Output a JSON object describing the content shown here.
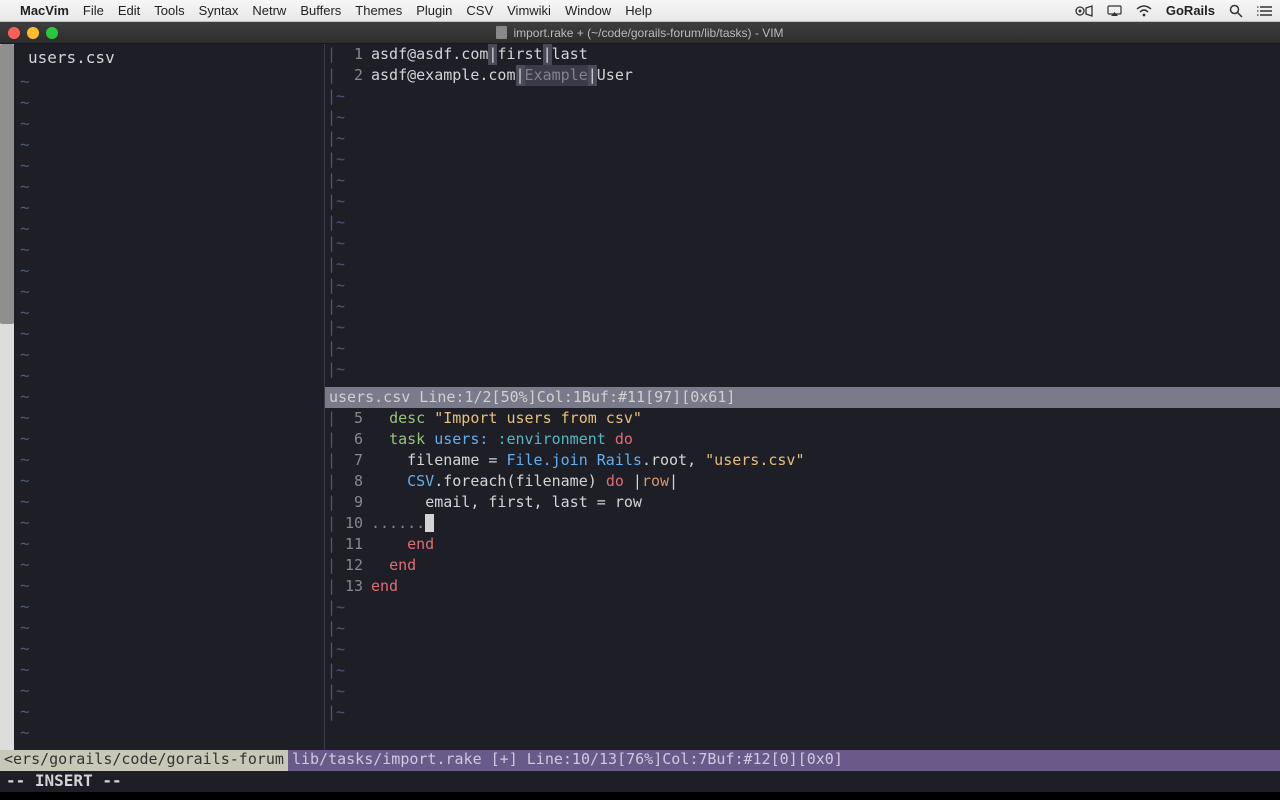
{
  "menubar": {
    "apple": "",
    "app": "MacVim",
    "items": [
      "File",
      "Edit",
      "Tools",
      "Syntax",
      "Netrw",
      "Buffers",
      "Themes",
      "Plugin",
      "CSV",
      "Vimwiki",
      "Window",
      "Help"
    ],
    "right_label": "GoRails"
  },
  "window": {
    "title": "import.rake + (~/code/gorails-forum/lib/tasks) - VIM"
  },
  "left_pane": {
    "file": "users.csv"
  },
  "top_pane": {
    "lines": [
      {
        "n": "1",
        "email": "asdf@asdf.com",
        "c1": "first",
        "c2": "last"
      },
      {
        "n": "2",
        "email": "asdf@example.com",
        "c1": "Example",
        "c2": "User"
      }
    ],
    "status": "users.csv  Line:1/2[50%]Col:1Buf:#11[97][0x61]"
  },
  "bottom_pane": {
    "lines": [
      {
        "n": "5",
        "type": "desc"
      },
      {
        "n": "6",
        "type": "task"
      },
      {
        "n": "7",
        "type": "filename"
      },
      {
        "n": "8",
        "type": "foreach"
      },
      {
        "n": "9",
        "type": "destruct"
      },
      {
        "n": "10",
        "type": "dots"
      },
      {
        "n": "11",
        "type": "end2"
      },
      {
        "n": "12",
        "type": "end1"
      },
      {
        "n": "13",
        "type": "end0"
      }
    ],
    "tokens": {
      "desc": "desc",
      "desc_str": "\"Import users from csv\"",
      "task": "task",
      "users": "users:",
      "environment": ":environment",
      "do": "do",
      "filename_assign": "filename = ",
      "file_join": "File.join ",
      "rails": "Rails",
      "dot_root": ".root, ",
      "users_csv": "\"users.csv\"",
      "csv": "CSV",
      "foreach": ".foreach(filename) ",
      "pipe": "|",
      "row": "row",
      "destruct": "email, first, last = row",
      "dots": "......",
      "end": "end"
    }
  },
  "main_status": {
    "left": "<ers/gorails/code/gorails-forum ",
    "right": "lib/tasks/import.rake [+] Line:10/13[76%]Col:7Buf:#12[0][0x0]"
  },
  "mode": "-- INSERT --"
}
